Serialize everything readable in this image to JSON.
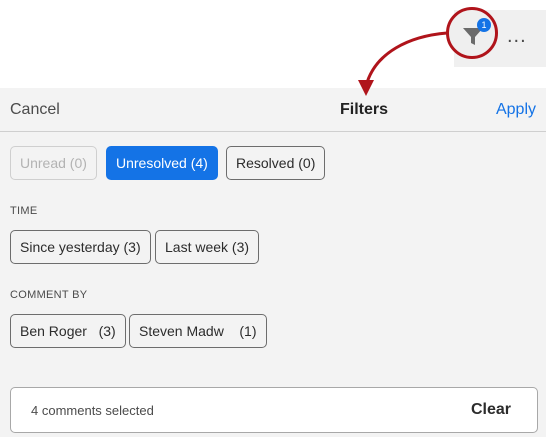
{
  "toolbar": {
    "filter_badge_count": "1",
    "more_label": "..."
  },
  "header": {
    "cancel_label": "Cancel",
    "title": "Filters",
    "apply_label": "Apply"
  },
  "status_filters": [
    {
      "label": "Unread (0)",
      "state": "disabled"
    },
    {
      "label": "Unresolved (4)",
      "state": "selected"
    },
    {
      "label": "Resolved (0)",
      "state": "normal"
    }
  ],
  "time": {
    "label": "TIME",
    "options": [
      "Since yesterday (3)",
      "Last week (3)"
    ]
  },
  "comment_by": {
    "label": "COMMENT BY",
    "options": [
      "Ben Roger   (3)",
      "Steven Madw    (1)"
    ]
  },
  "footer": {
    "selected_text": "4 comments selected",
    "clear_label": "Clear"
  },
  "colors": {
    "accent": "#1473e6",
    "annotation": "#b0141b"
  }
}
